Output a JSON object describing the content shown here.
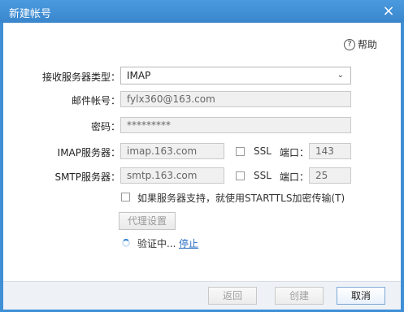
{
  "window": {
    "title": "新建帐号",
    "close_glyph": "×"
  },
  "help": {
    "label": "帮助",
    "icon": "help-icon"
  },
  "form": {
    "server_type": {
      "label": "接收服务器类型：",
      "value": "IMAP"
    },
    "account": {
      "label": "邮件帐号：",
      "value": "fylx360@163.com"
    },
    "password": {
      "label": "密码：",
      "value": "*********"
    },
    "imap": {
      "label": "IMAP服务器：",
      "value": "imap.163.com",
      "ssl_label": "SSL",
      "port_label": "端口：",
      "port_value": "143"
    },
    "smtp": {
      "label": "SMTP服务器：",
      "value": "smtp.163.com",
      "ssl_label": "SSL",
      "port_label": "端口：",
      "port_value": "25"
    },
    "starttls_label": "如果服务器支持，就使用STARTTLS加密传输(T)",
    "proxy_button": "代理设置",
    "status_text": "验证中...",
    "stop_link": "停止"
  },
  "footer": {
    "back": "返回",
    "create": "创建",
    "cancel": "取消"
  },
  "colors": {
    "titlebar": "#3f8fd6",
    "link": "#2a6fc1"
  }
}
